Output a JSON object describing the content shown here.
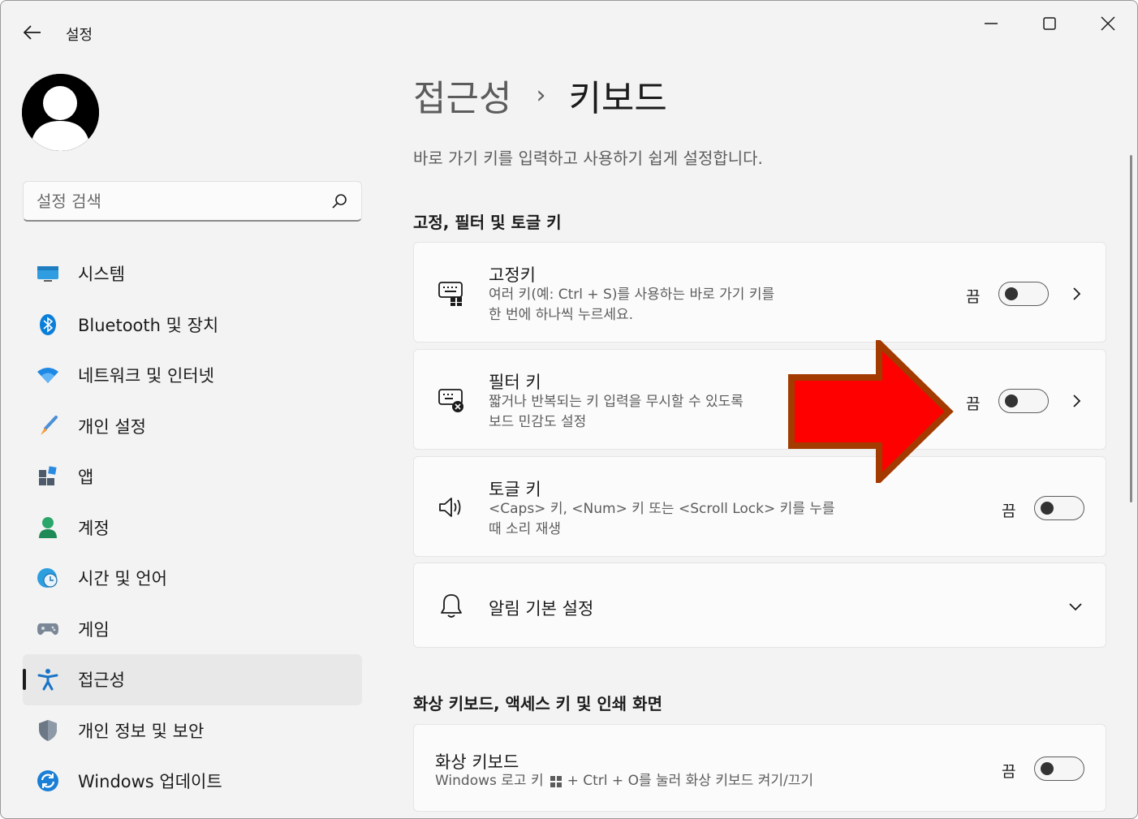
{
  "window": {
    "app_title": "설정"
  },
  "sidebar": {
    "search_placeholder": "설정 검색",
    "items": [
      {
        "label": "시스템",
        "icon": "system-icon"
      },
      {
        "label": "Bluetooth 및 장치",
        "icon": "bluetooth-icon"
      },
      {
        "label": "네트워크 및 인터넷",
        "icon": "wifi-icon"
      },
      {
        "label": "개인 설정",
        "icon": "brush-icon"
      },
      {
        "label": "앱",
        "icon": "apps-icon"
      },
      {
        "label": "계정",
        "icon": "account-icon"
      },
      {
        "label": "시간 및 언어",
        "icon": "globe-clock-icon"
      },
      {
        "label": "게임",
        "icon": "gamepad-icon"
      },
      {
        "label": "접근성",
        "icon": "accessibility-icon",
        "active": true
      },
      {
        "label": "개인 정보 및 보안",
        "icon": "shield-icon"
      },
      {
        "label": "Windows 업데이트",
        "icon": "update-icon"
      }
    ]
  },
  "main": {
    "breadcrumb_parent": "접근성",
    "breadcrumb_sep": "›",
    "breadcrumb_current": "키보드",
    "subtitle": "바로 가기 키를 입력하고 사용하기 쉽게 설정합니다.",
    "section1_title": "고정, 필터 및 토글 키",
    "section2_title": "화상 키보드, 액세스 키 및 인쇄 화면",
    "cards": {
      "sticky": {
        "title": "고정키",
        "desc_line1": "여러 키(예: Ctrl + S)를 사용하는 바로 가기 키를",
        "desc_line2": "한 번에 하나씩 누르세요.",
        "state": "끔"
      },
      "filter": {
        "title": "필터 키",
        "desc_line1": "짧거나 반복되는 키 입력을 무시할 수 있도록",
        "desc_line2": "보드 민감도 설정",
        "state": "끔"
      },
      "toggle": {
        "title": "토글 키",
        "desc_line1": "<Caps> 키, <Num> 키 또는 <Scroll Lock> 키를 누를",
        "desc_line2": "때 소리 재생",
        "state": "끔"
      },
      "notify": {
        "title": "알림 기본 설정"
      },
      "osk": {
        "title": "화상 키보드",
        "desc_part1": "Windows 로고 키",
        "desc_part2": "+ Ctrl + O를 눌러 화상 키보드 켜기/끄기",
        "state": "끔"
      }
    }
  },
  "colors": {
    "arrow_fill": "#ff0000",
    "arrow_stroke": "#a33a00",
    "accent_blue": "#0067c0"
  }
}
